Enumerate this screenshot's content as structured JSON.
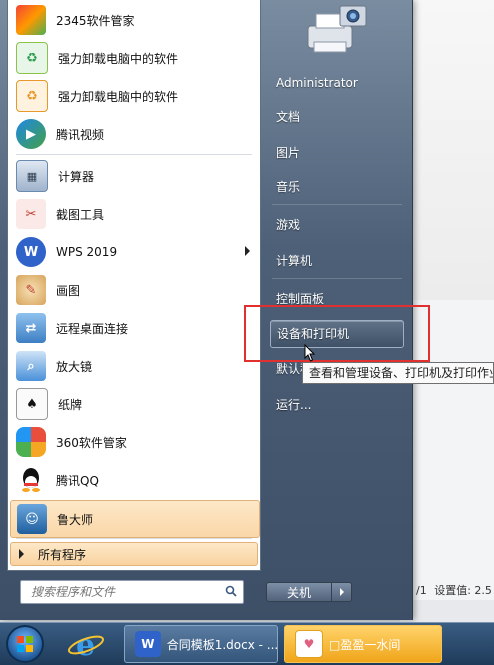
{
  "programs": [
    {
      "label": "2345软件管家",
      "icon": "2345-softmanager-icon",
      "color": "#f5a623"
    },
    {
      "label": "强力卸载电脑中的软件",
      "icon": "uninstall-green-icon",
      "color": "#2e9e4f"
    },
    {
      "label": "强力卸载电脑中的软件",
      "icon": "uninstall-orange-icon",
      "color": "#e8972a"
    },
    {
      "label": "腾讯视频",
      "icon": "tencent-video-icon",
      "color": "#1e88e5"
    },
    {
      "label": "计算器",
      "icon": "calculator-icon",
      "color": "#6a8bb0"
    },
    {
      "label": "截图工具",
      "icon": "snipping-tool-icon",
      "color": "#c0392b"
    },
    {
      "label": "WPS 2019",
      "icon": "wps-icon",
      "color": "#2f63c9"
    },
    {
      "label": "画图",
      "icon": "paint-icon",
      "color": "#d7a35a"
    },
    {
      "label": "远程桌面连接",
      "icon": "remote-desktop-icon",
      "color": "#3d7fc4"
    },
    {
      "label": "放大镜",
      "icon": "magnifier-icon",
      "color": "#4a90d9"
    },
    {
      "label": "纸牌",
      "icon": "solitaire-icon",
      "color": "#777777"
    },
    {
      "label": "360软件管家",
      "icon": "360-softmanager-icon",
      "color": "#e94e3c"
    },
    {
      "label": "腾讯QQ",
      "icon": "qq-icon",
      "color": "#222222"
    },
    {
      "label": "鲁大师",
      "icon": "ludashi-icon",
      "color": "#2a6fb0"
    }
  ],
  "all_programs": "所有程序",
  "search": {
    "placeholder": "搜索程序和文件"
  },
  "right": {
    "user": "Administrator",
    "documents": "文档",
    "pictures": "图片",
    "music": "音乐",
    "games": "游戏",
    "computer": "计算机",
    "control_panel": "控制面板",
    "devices_printers": "设备和打印机",
    "default_programs": "默认程序",
    "run": "运行..."
  },
  "tooltip": "查看和管理设备、打印机及打印作业",
  "shutdown": "关机",
  "background": {
    "status_fraction": "/1",
    "status_setting": "设置值: 2.5"
  },
  "taskbar": {
    "wps_task": "合同模板1.docx - ...",
    "game_task": "□盈盈一水间"
  }
}
